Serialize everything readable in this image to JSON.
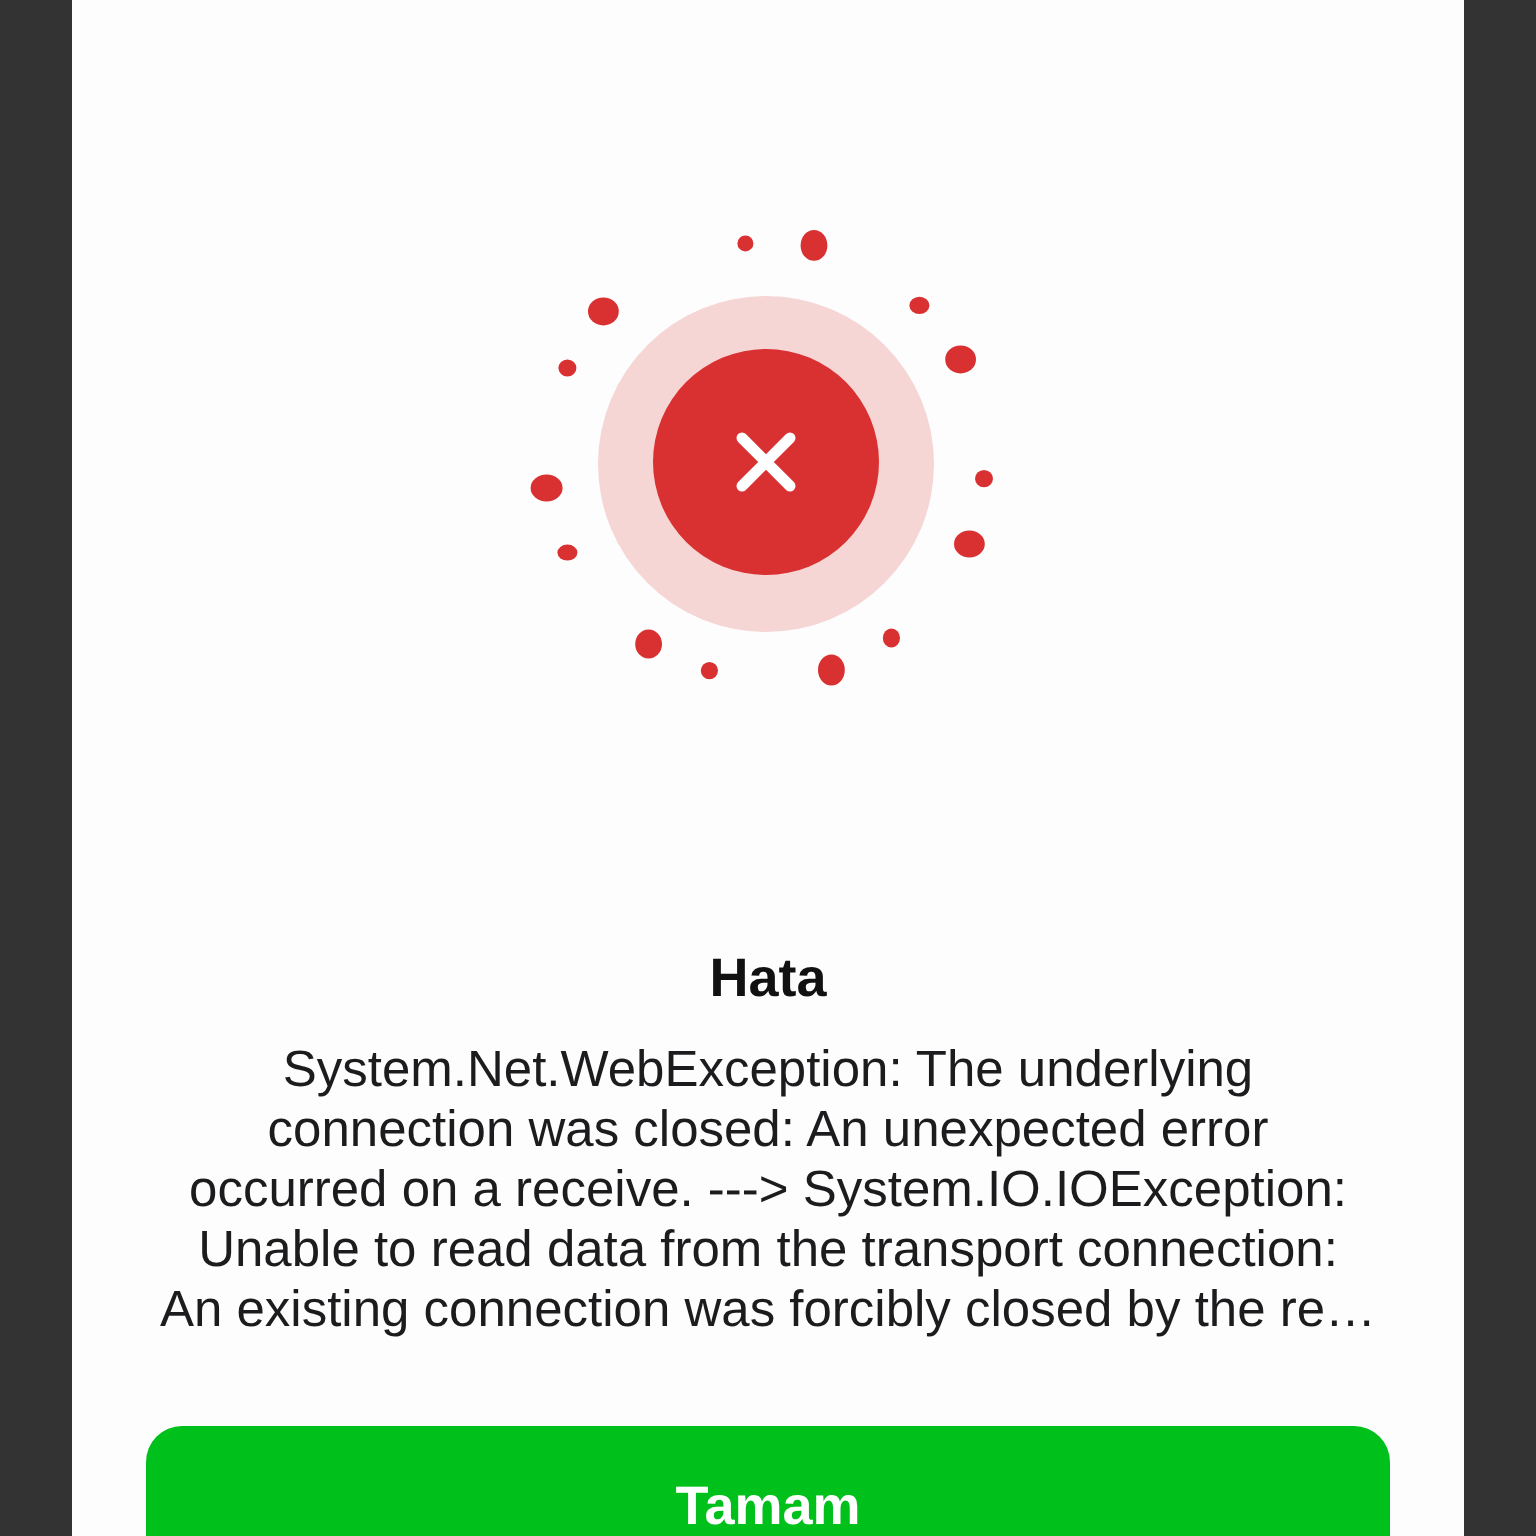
{
  "dialog": {
    "title": "Hata",
    "message": "System.Net.WebException: The underlying\nconnection was closed: An unexpected error\noccurred on a receive. ---> System.IO.IOException:\nUnable to read data from the transport connection:\nAn existing connection was forcibly closed by the re…",
    "button": "Tamam"
  }
}
